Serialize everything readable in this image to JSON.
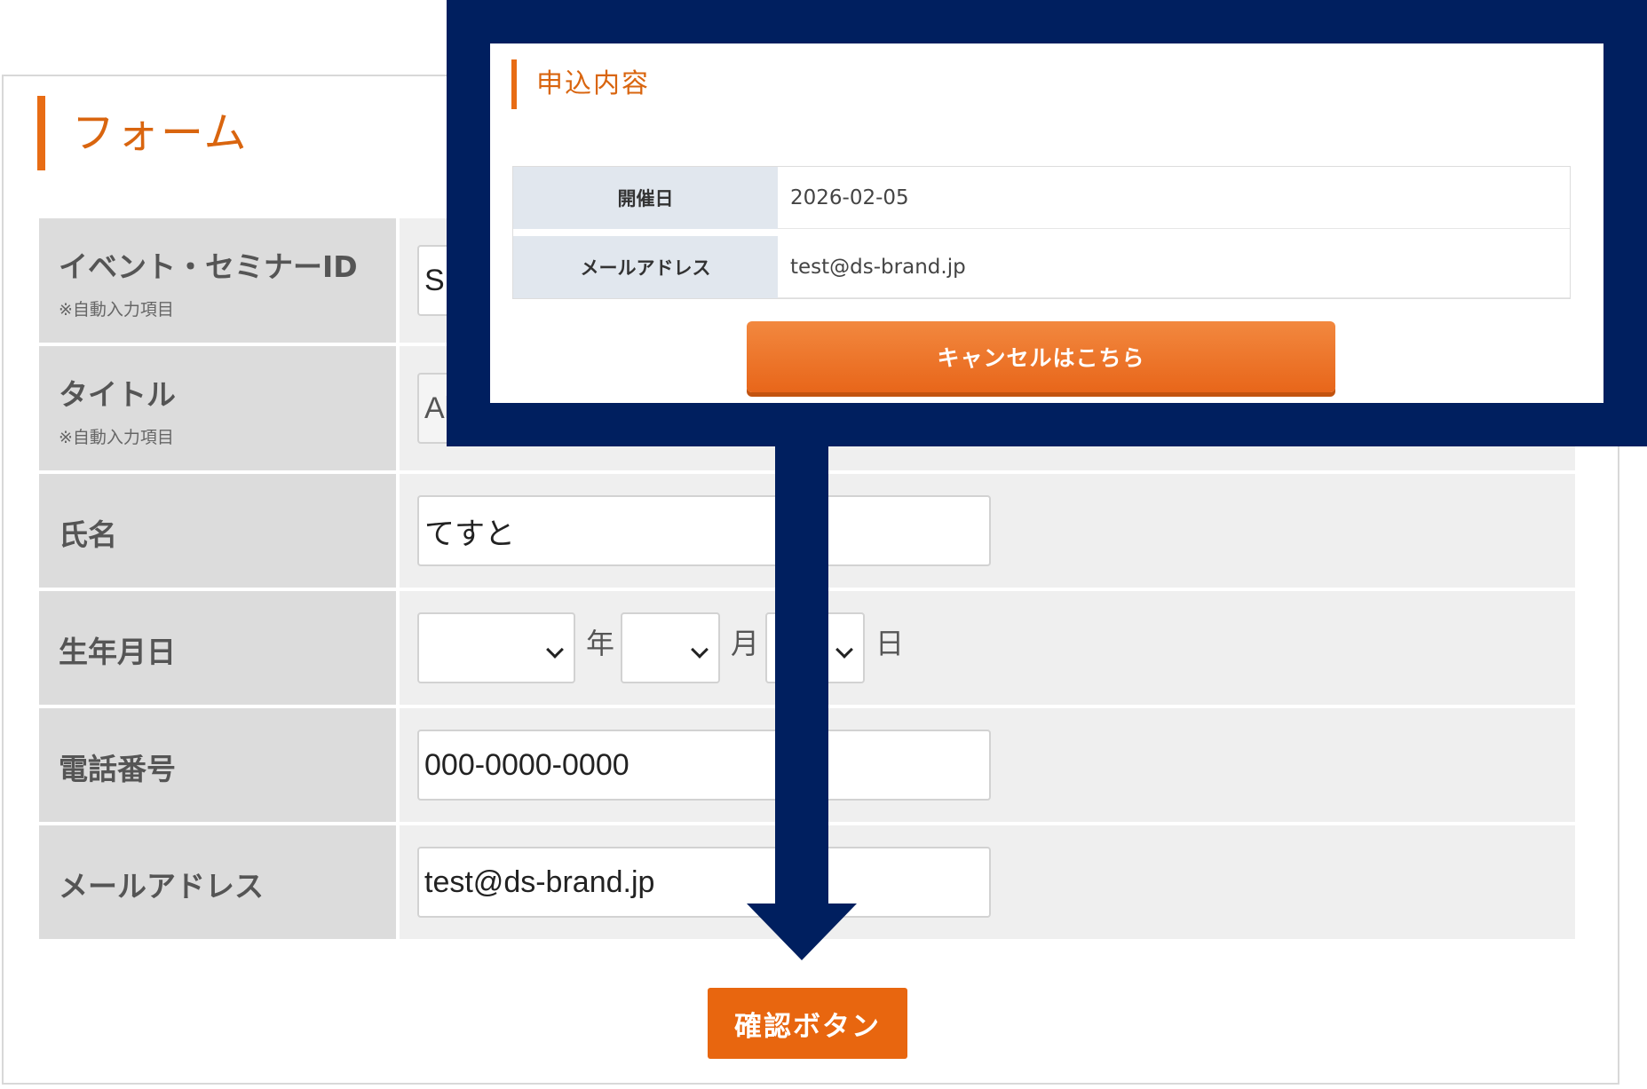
{
  "form": {
    "title": "フォーム",
    "rows": [
      {
        "label": "イベント・セミナーID",
        "sub": "※自動入力項目",
        "value": "S"
      },
      {
        "label": "タイトル",
        "sub": "※自動入力項目",
        "value": "Al"
      },
      {
        "label": "氏名",
        "value": "てすと"
      },
      {
        "label": "生年月日",
        "year_unit": "年",
        "month_unit": "月",
        "day_unit": "日"
      },
      {
        "label": "電話番号",
        "value": "000-0000-0000"
      },
      {
        "label": "メールアドレス",
        "value": "test@ds-brand.jp"
      }
    ],
    "confirm_label": "確認ボタン"
  },
  "overlay": {
    "title": "申込内容",
    "rows": [
      {
        "label": "開催日",
        "value": "2026-02-05"
      },
      {
        "label": "メールアドレス",
        "value": "test@ds-brand.jp"
      }
    ],
    "cancel_label": "キャンセルはこちら"
  },
  "colors": {
    "accent": "#e8660f",
    "navy": "#001f5f",
    "label_bg": "#dcdcdc",
    "value_bg": "#efefef"
  }
}
